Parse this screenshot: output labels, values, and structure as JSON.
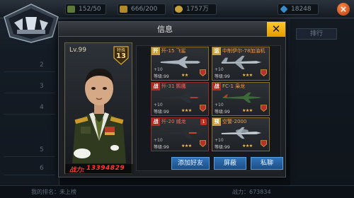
{
  "topbar": {
    "stats": [
      {
        "icon": "fuel-icon",
        "value": "152/50"
      },
      {
        "icon": "gold-icon",
        "value": "666/200"
      },
      {
        "icon": "coin-icon",
        "value": "1757万"
      },
      {
        "icon": "gem-icon",
        "value": "18248"
      }
    ]
  },
  "background": {
    "rank_button": "排行",
    "left_rows": [
      "2",
      "3",
      "4",
      "5",
      "6"
    ],
    "my_rank": "我的排名：未上榜",
    "my_power": "战力：673834"
  },
  "modal": {
    "title": "信息",
    "close": "✕",
    "player": {
      "level": "Lv.99",
      "rank_label": "特殊",
      "rank_number": "13",
      "power_label": "战力:",
      "power_value": "13394829"
    },
    "cards": [
      {
        "type": "歼",
        "name": "歼-15 飞鲨",
        "plus": "+10",
        "level": "等级:99",
        "stars": "★★",
        "badge": "",
        "accent": "#c9a137",
        "style": "gold"
      },
      {
        "type": "运",
        "name": "中制伊尔-78加油机",
        "plus": "+10",
        "level": "等级:99",
        "stars": "★★★",
        "badge": "",
        "accent": "#c9a137",
        "style": "gold"
      },
      {
        "type": "战",
        "name": "歼-31 鹘鹰",
        "plus": "+10",
        "level": "等级:99",
        "stars": "★★★",
        "badge": "",
        "accent": "#b7281f",
        "style": "red"
      },
      {
        "type": "战",
        "name": "FC-1 枭龙",
        "plus": "+10",
        "level": "等级:99",
        "stars": "★★★",
        "badge": "",
        "accent": "#b7281f",
        "style": "gold"
      },
      {
        "type": "战",
        "name": "歼-20 威龙",
        "plus": "+10",
        "level": "等级:99",
        "stars": "★★★",
        "badge": "1",
        "accent": "#b7281f",
        "style": "red"
      },
      {
        "type": "预",
        "name": "空警-2000",
        "plus": "+10",
        "level": "等级:99",
        "stars": "★★★",
        "badge": "",
        "accent": "#c9a137",
        "style": "gold"
      }
    ],
    "buttons": {
      "add_friend": "添加好友",
      "block": "屏蔽",
      "private_chat": "私聊"
    }
  },
  "colors": {
    "power_red": "#ff3b2f",
    "card_gold_border": "#8a6b2a",
    "card_red_border": "#9b2a22",
    "button_blue": "#2f73b8",
    "close_yellow": "#ffc928"
  }
}
